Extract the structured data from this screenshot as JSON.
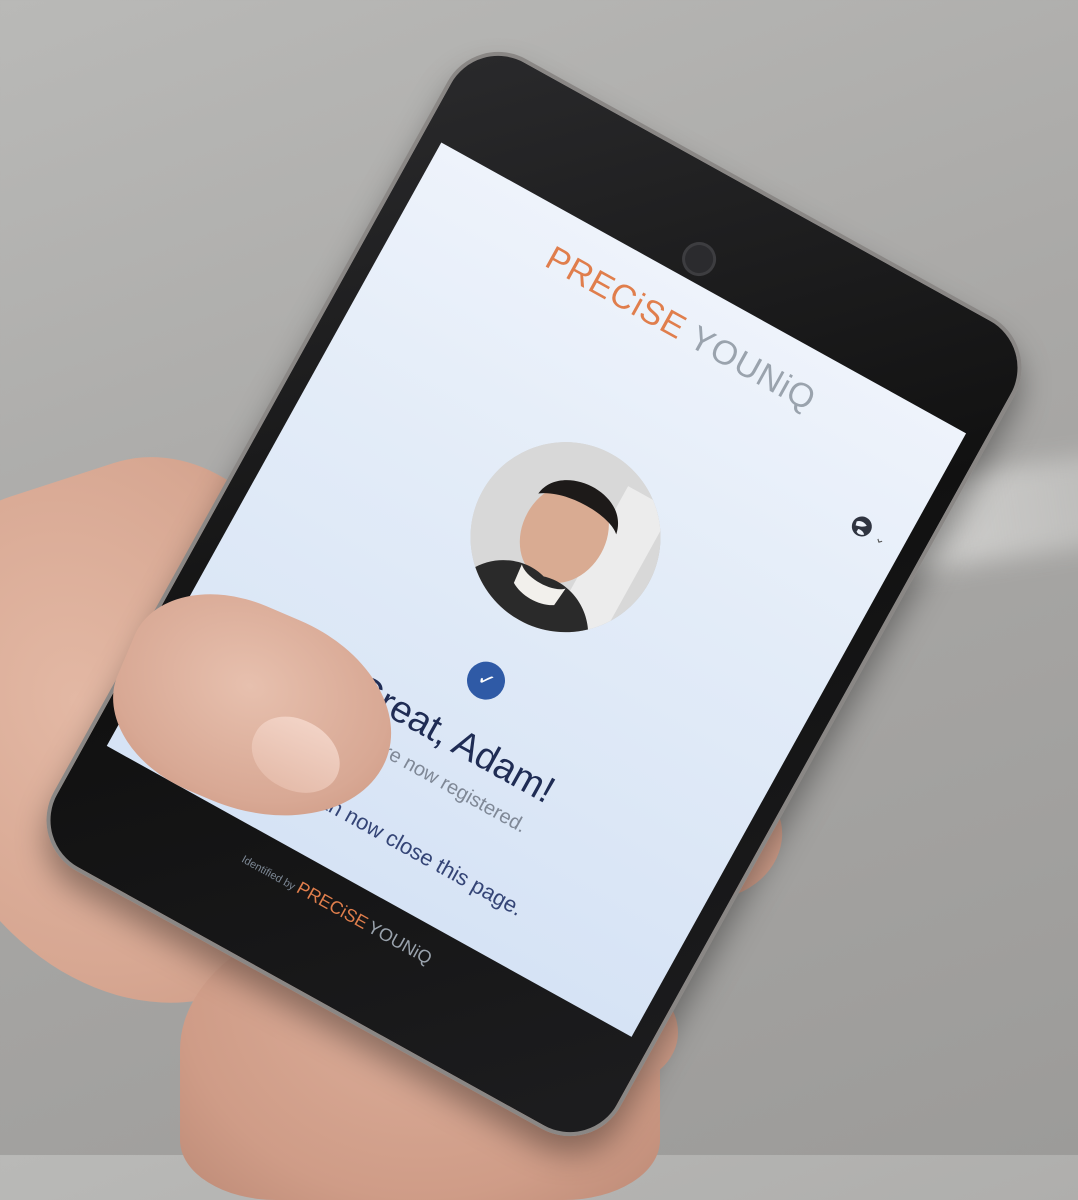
{
  "app": {
    "brand_primary": "PRECiSE",
    "brand_secondary": "YOUNiQ"
  },
  "header": {
    "language_icon": "globe-icon",
    "language_chevron": "⌄"
  },
  "result": {
    "status_icon": "check-icon",
    "title": "Great, Adam!",
    "subtitle": "You are now registered.",
    "instruction": "You can now close this page."
  },
  "footer": {
    "prefix": "Identified by",
    "brand_primary": "PRECiSE",
    "brand_secondary": "YOUNiQ"
  },
  "colors": {
    "brand_orange": "#e07e4c",
    "brand_gray": "#9aa3ad",
    "check_blue": "#2f5aa6",
    "heading_navy": "#1f2c54"
  }
}
